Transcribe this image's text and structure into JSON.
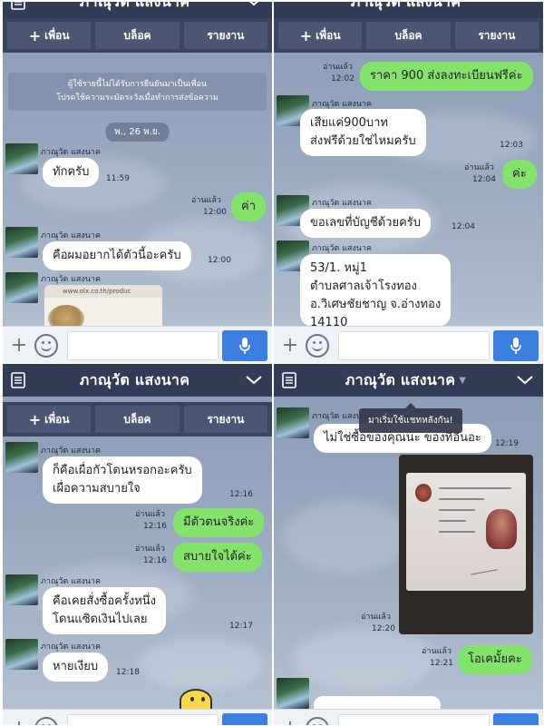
{
  "common": {
    "contact_name": "ภาณุวัต แสงนาค",
    "add_friend_label": "เพื่อน",
    "block_label": "บล็อค",
    "report_label": "รายงาน",
    "read_label": "อ่านแล้ว"
  },
  "panel1": {
    "system_notice_line1": "ผู้ใช้รายนี้ไม่ได้รับการยืนยันมาเป็นเพื่อน",
    "system_notice_line2": "โปรดใช้ความระมัดระวังเมื่อทำการส่งข้อความ",
    "date_label": "พ., 26 พ.ย.",
    "messages": [
      {
        "sender": "ภาณุวัต แสงนาค",
        "text": "ทักครับ",
        "time": "11:59"
      },
      {
        "text": "ค่า",
        "time": "12:00",
        "status": "อ่านแล้ว"
      },
      {
        "sender": "ภาณุวัต แสงนาค",
        "text": "คือผมอยากได้ตัวนี้อะครับ",
        "time": "12:00"
      },
      {
        "sender": "ภาณุวัต แสงนาค",
        "link_url": "www.olx.co.th/produc"
      }
    ]
  },
  "panel2": {
    "messages": [
      {
        "text": "ราคา 900 ส่งลงทะเบียนฟรีค่ะ",
        "time": "12:02",
        "status": "อ่านแล้ว"
      },
      {
        "sender": "ภาณุวัต แสงนาค",
        "line1": "เสียแค่900บาท",
        "line2": "ส่งฟรีด้วยใช่ไหมครับ",
        "time": "12:03"
      },
      {
        "text": "ค่ะ",
        "time": "12:04",
        "status": "อ่านแล้ว"
      },
      {
        "sender": "ภาณุวัต แสงนาค",
        "text": "ขอเลขที่บัญชีด้วยครับ",
        "time": "12:04"
      },
      {
        "sender": "ภาณุวัต แสงนาค",
        "line1": "53/1. หมู่1",
        "line2": "ตำบลศาลเจ้าโรงทอง",
        "line3": "อ.วิเศษชัยชาญ จ.อ่างทอง",
        "line4": "14110"
      }
    ]
  },
  "panel3": {
    "messages": [
      {
        "sender": "ภาณุวัต แสงนาค",
        "line1": "ก็คือเผื่อกัวโดนหรอกอะครับ",
        "line2": "เผื่อความสบายใจ",
        "time": "12:16"
      },
      {
        "text": "มีตัวตนจริงค่ะ",
        "time": "12:16",
        "status": "อ่านแล้ว"
      },
      {
        "text": "สบายใจได้ค่ะ",
        "time": "12:16",
        "status": "อ่านแล้ว"
      },
      {
        "sender": "ภาณุวัต แสงนาค",
        "line1": "คือเคยสั่งซื้อครั้งหนึ่ง",
        "line2": "โดนแซิดเงินไปเลย",
        "time": "12:17"
      },
      {
        "sender": "ภาณุวัต แสงนาค",
        "text": "หายเงียบ",
        "time": "12:18"
      }
    ]
  },
  "panel4": {
    "toast": "มาเริ่มใช้แชทหลังกัน!",
    "messages": [
      {
        "sender": "ภาณุวัต แสงนาค",
        "text": "ไม่ใช่ซื้อของคุณนะ ของที่อื่นอะ",
        "time": "12:19"
      },
      {
        "image": "id-card-photo",
        "time": "12:20",
        "status": "อ่านแล้ว"
      },
      {
        "text": "โอเคมั้ยคะ",
        "time": "12:21",
        "status": "อ่านแล้ว"
      }
    ]
  }
}
